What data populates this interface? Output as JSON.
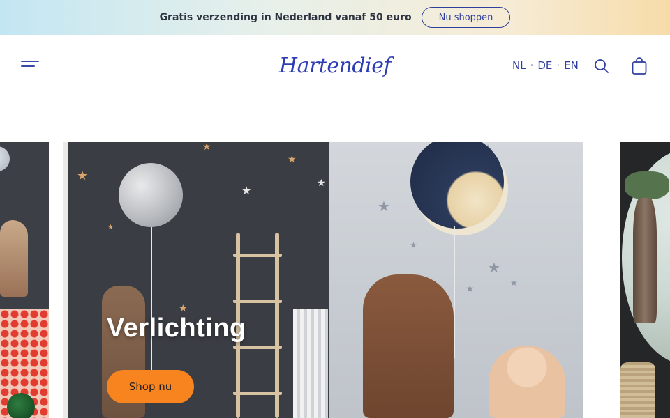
{
  "announcement": {
    "text": "Gratis verzending in Nederland vanaf 50 euro",
    "button_label": "Nu shoppen"
  },
  "header": {
    "logo_text": "Hartendief",
    "languages": [
      {
        "code": "NL",
        "active": true
      },
      {
        "code": "DE",
        "active": false
      },
      {
        "code": "EN",
        "active": false
      }
    ],
    "separator": "·",
    "icons": {
      "menu": "hamburger-menu-icon",
      "search": "search-icon",
      "cart": "shopping-bag-icon"
    }
  },
  "hero": {
    "title": "Verlichting",
    "button_label": "Shop nu"
  },
  "colors": {
    "brand_blue": "#2f3f9b",
    "cta_orange": "#f7841f"
  }
}
